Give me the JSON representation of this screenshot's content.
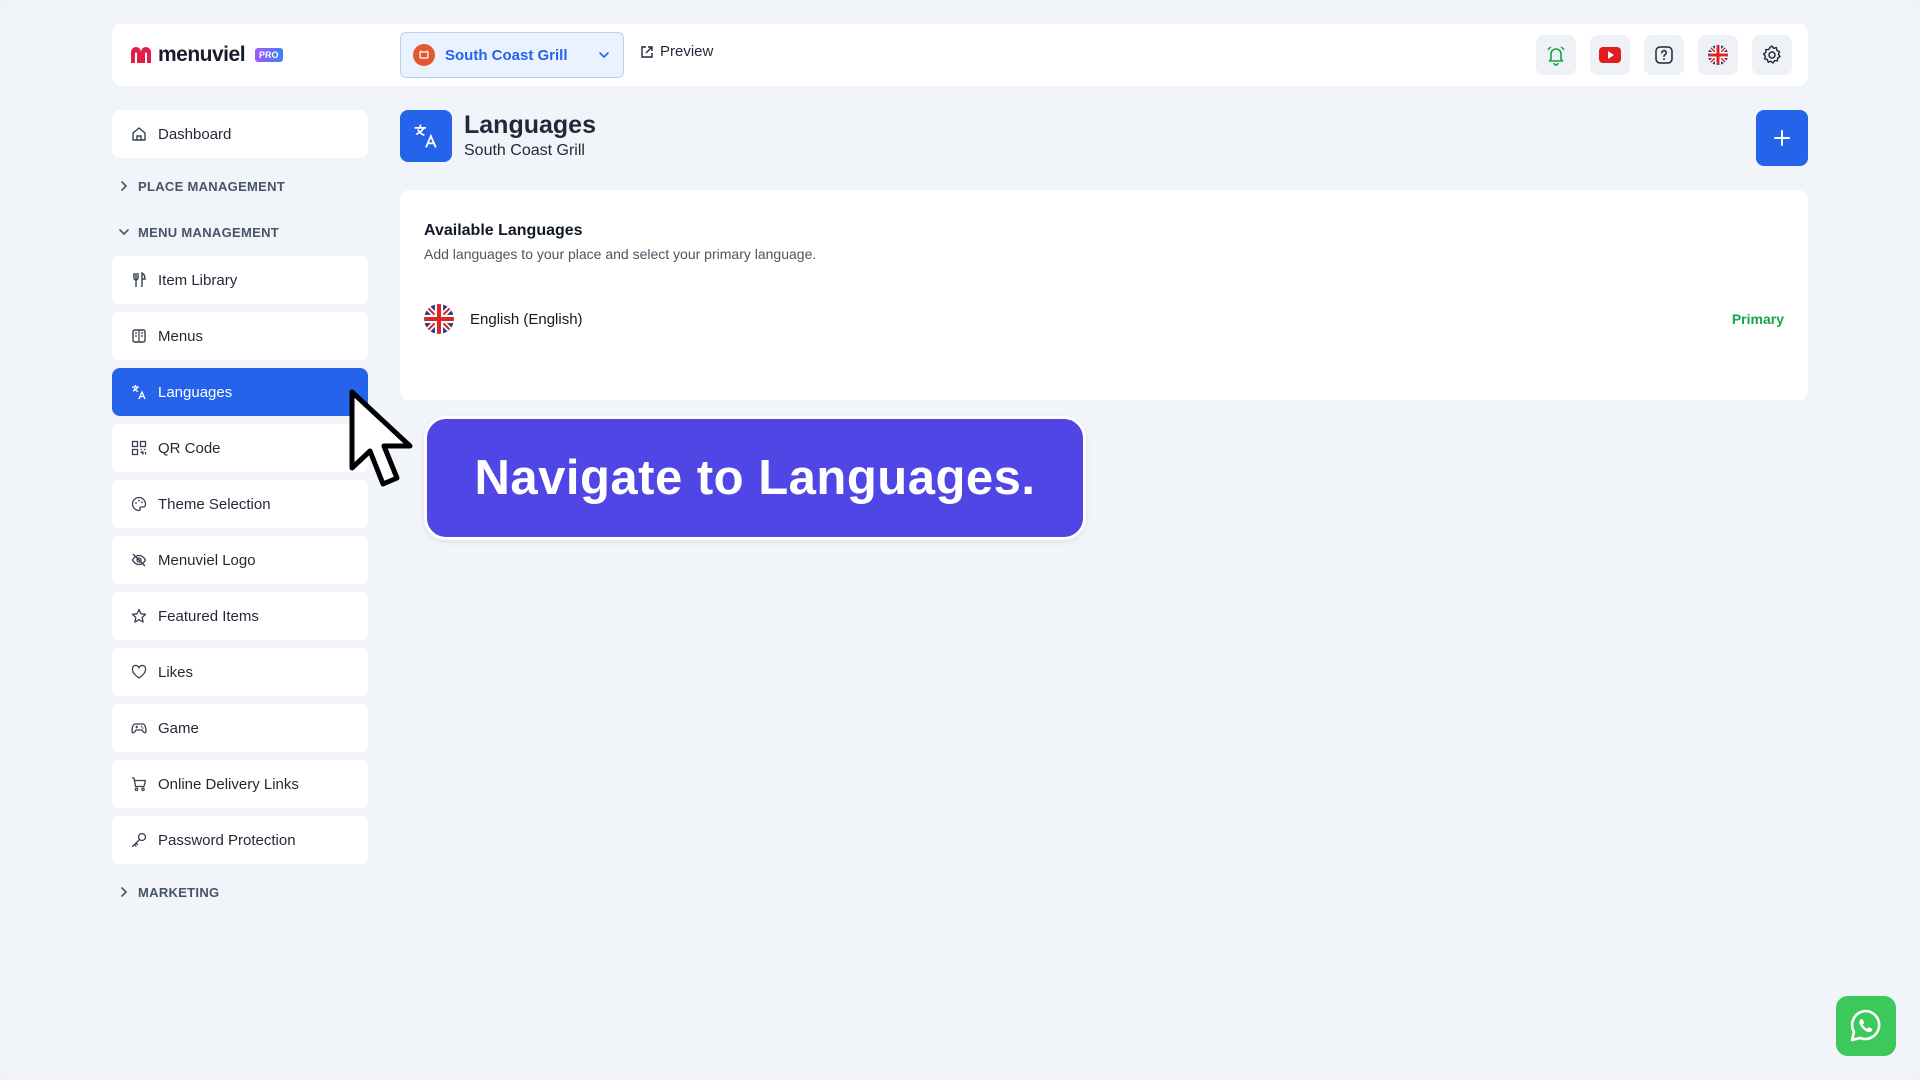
{
  "app": {
    "brand": "menuviel",
    "badge": "PRO"
  },
  "header": {
    "place": "South Coast Grill",
    "preview_label": "Preview",
    "icons": [
      "bell-icon",
      "youtube-icon",
      "help-icon",
      "uk-flag-icon",
      "gear-icon"
    ]
  },
  "sidebar": {
    "dashboard": "Dashboard",
    "sections": {
      "place_management": "PLACE MANAGEMENT",
      "menu_management": "MENU MANAGEMENT",
      "marketing": "MARKETING"
    },
    "items": [
      {
        "label": "Item Library",
        "icon": "utensils-icon"
      },
      {
        "label": "Menus",
        "icon": "book-icon"
      },
      {
        "label": "Languages",
        "icon": "translate-icon",
        "active": true
      },
      {
        "label": "QR Code",
        "icon": "qr-icon"
      },
      {
        "label": "Theme Selection",
        "icon": "palette-icon"
      },
      {
        "label": "Menuviel Logo",
        "icon": "eye-off-icon"
      },
      {
        "label": "Featured Items",
        "icon": "star-icon"
      },
      {
        "label": "Likes",
        "icon": "heart-icon"
      },
      {
        "label": "Game",
        "icon": "gamepad-icon"
      },
      {
        "label": "Online Delivery Links",
        "icon": "cart-icon"
      },
      {
        "label": "Password Protection",
        "icon": "key-icon"
      }
    ]
  },
  "main": {
    "title": "Languages",
    "subtitle": "South Coast Grill",
    "card": {
      "title": "Available Languages",
      "description": "Add languages to your place and select your primary language.",
      "languages": [
        {
          "name": "English (English)",
          "status": "Primary"
        }
      ]
    }
  },
  "tooltip": {
    "text": "Navigate to Languages."
  },
  "colors": {
    "accent": "#2563eb",
    "tooltip": "#4f46e5",
    "primary_green": "#16a34a",
    "whatsapp": "#3cc85a"
  }
}
